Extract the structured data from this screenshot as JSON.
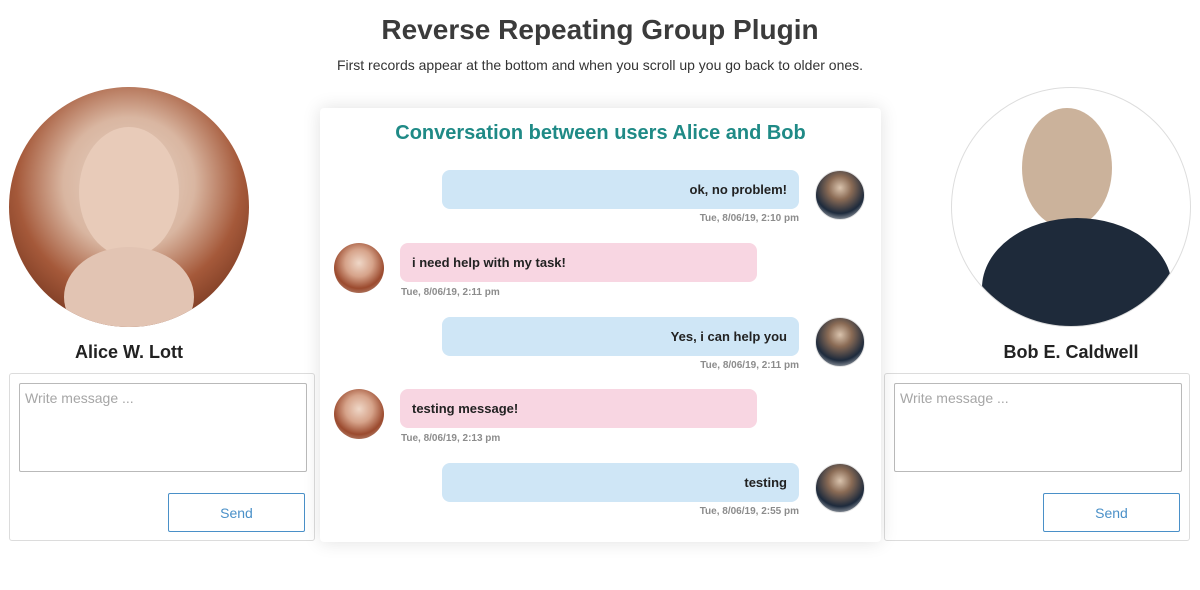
{
  "page": {
    "title": "Reverse Repeating Group Plugin",
    "subtitle": "First records appear at the bottom and when you scroll up you go back to older ones."
  },
  "alice": {
    "name": "Alice W. Lott",
    "message_placeholder": "Write message ...",
    "send_label": "Send"
  },
  "bob": {
    "name": "Bob E. Caldwell",
    "message_placeholder": "Write message ...",
    "send_label": "Send"
  },
  "conversation": {
    "title": "Conversation between users Alice and Bob",
    "messages": [
      {
        "sender": "bob",
        "text": "ok, no problem!",
        "time": "Tue, 8/06/19, 2:10 pm"
      },
      {
        "sender": "alice",
        "text": "i need help with my task!",
        "time": "Tue, 8/06/19, 2:11 pm"
      },
      {
        "sender": "bob",
        "text": "Yes, i can help you",
        "time": "Tue, 8/06/19, 2:11 pm"
      },
      {
        "sender": "alice",
        "text": "testing message!",
        "time": "Tue, 8/06/19, 2:13 pm"
      },
      {
        "sender": "bob",
        "text": "testing",
        "time": "Tue, 8/06/19, 2:55 pm"
      }
    ]
  },
  "colors": {
    "accent_title": "#1f8a86",
    "bob_bubble": "#cfe6f6",
    "alice_bubble": "#f8d6e2",
    "send_button": "#4a90c8"
  }
}
